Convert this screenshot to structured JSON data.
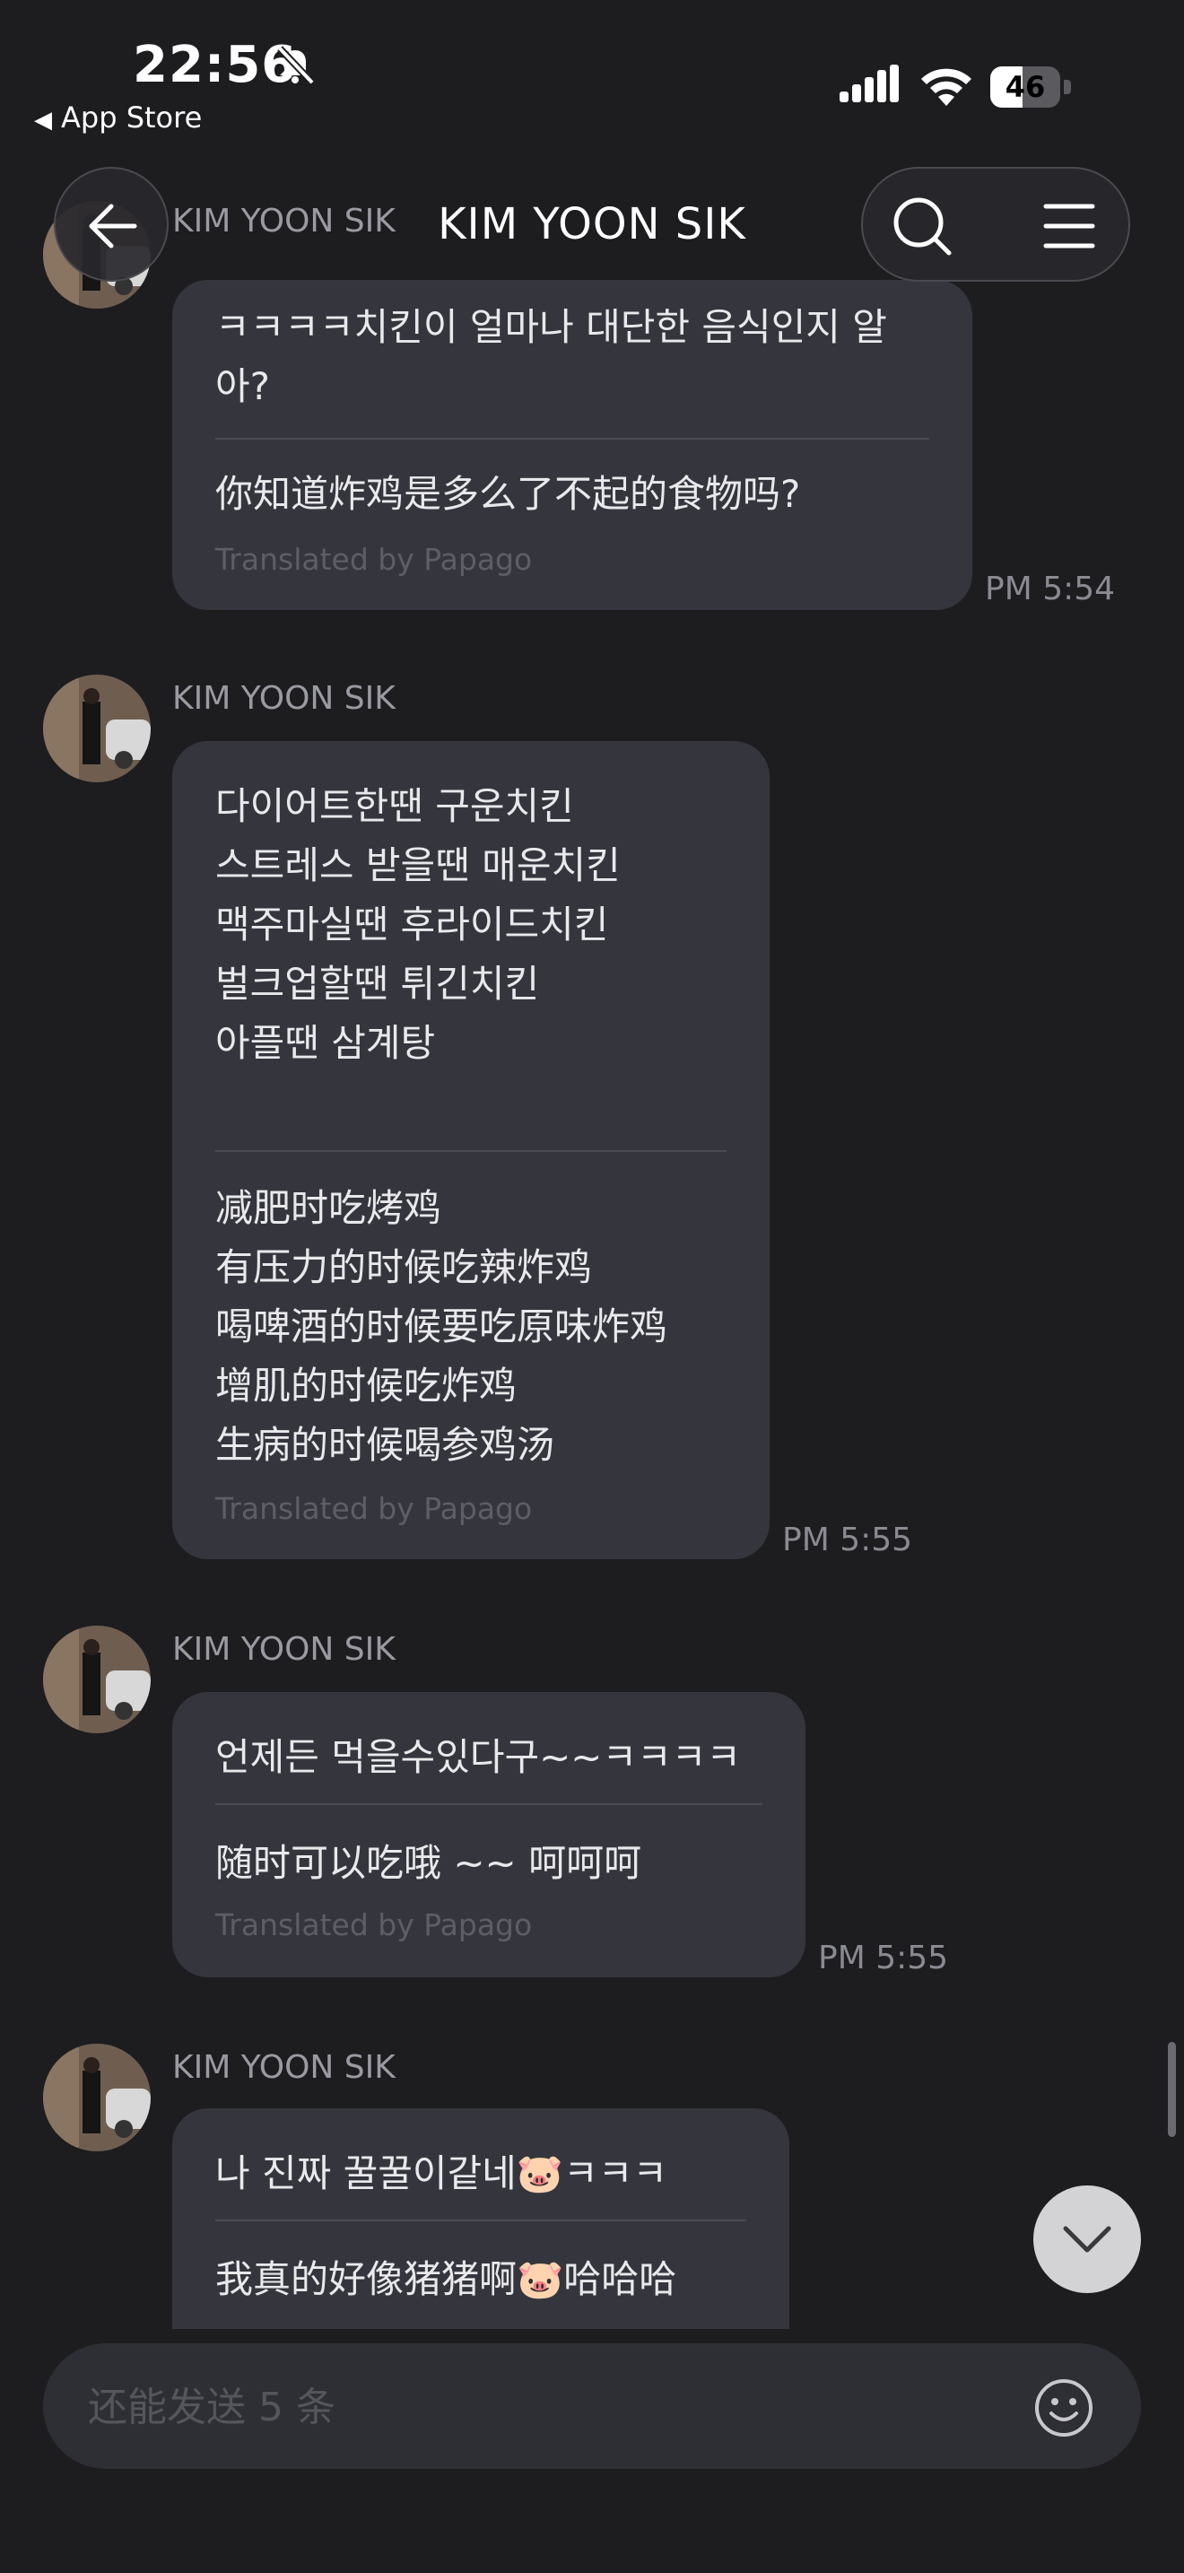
{
  "status_bar": {
    "time": "22:56",
    "back_app": "App Store",
    "battery": "46",
    "battery_level": 0.46
  },
  "header": {
    "title": "KIM YOON SIK"
  },
  "messages": [
    {
      "sender": "KIM YOON SIK",
      "original": "ㅋㅋㅋㅋ치킨이 얼마나 대단한 음식인지 알\n아?",
      "translation": "你知道炸鸡是多么了不起的食物吗?",
      "credit": "Translated by Papago",
      "time": "PM 5:54"
    },
    {
      "sender": "KIM YOON SIK",
      "original": "다이어트한땐 구운치킨\n스트레스 받을땐 매운치킨\n맥주마실땐 후라이드치킨\n벌크업할땐 튀긴치킨\n아플땐 삼계탕",
      "translation": "减肥时吃烤鸡\n有压力的时候吃辣炸鸡\n喝啤酒的时候要吃原味炸鸡\n增肌的时候吃炸鸡\n生病的时候喝参鸡汤",
      "credit": "Translated by Papago",
      "time": "PM 5:55"
    },
    {
      "sender": "KIM YOON SIK",
      "original": "언제든 먹을수있다구~~ㅋㅋㅋㅋ",
      "translation": "随时可以吃哦 ~~ 呵呵呵",
      "credit": "Translated by Papago",
      "time": "PM 5:55"
    },
    {
      "sender": "KIM YOON SIK",
      "original": "나 진짜 꿀꿀이같네🐷ㅋㅋㅋ",
      "translation": "我真的好像猪猪啊🐷哈哈哈"
    }
  ],
  "composer": {
    "placeholder": "还能发送 5 条"
  }
}
